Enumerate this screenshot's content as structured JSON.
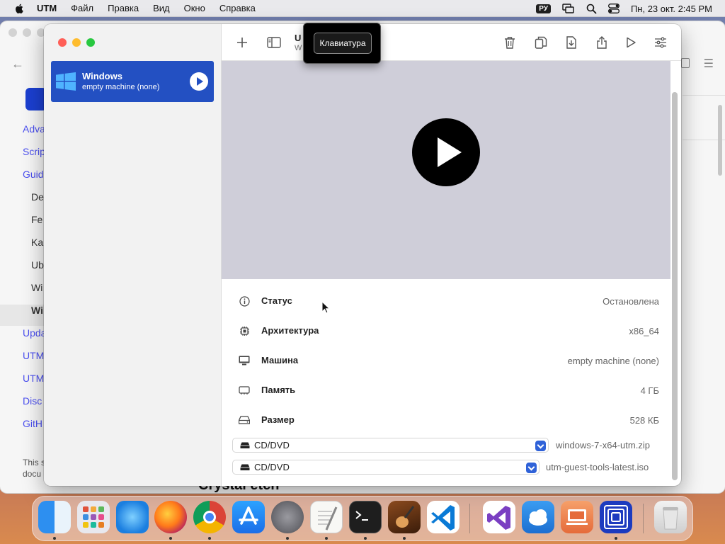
{
  "menubar": {
    "app_name": "UTM",
    "menus": [
      "Файл",
      "Правка",
      "Вид",
      "Окно",
      "Справка"
    ],
    "input_source": "РУ",
    "datetime": "Пн, 23 окт.  2:45 PM"
  },
  "background_window": {
    "sidebar_links": [
      "Adva",
      "Scrip",
      "Guid",
      "Upda",
      "UTM",
      "UTM",
      "Disc",
      "GitH"
    ],
    "sidebar_sublinks": [
      "De",
      "Fe",
      "Ka",
      "Ub",
      "Wi",
      "Wi"
    ],
    "footer_lines": [
      "This s",
      "docu"
    ],
    "heading_fragment": "Crystal etch"
  },
  "utm": {
    "vm": {
      "name": "Windows",
      "subtitle": "empty machine (none)"
    },
    "toolbar": {
      "title_fragment": "U",
      "subtitle_fragment": "W"
    },
    "tooltip": "Клавиатура",
    "info_rows": [
      {
        "icon": "info-icon",
        "label": "Статус",
        "value": "Остановлена"
      },
      {
        "icon": "cpu-icon",
        "label": "Архитектура",
        "value": "x86_64"
      },
      {
        "icon": "monitor-icon",
        "label": "Машина",
        "value": "empty machine (none)"
      },
      {
        "icon": "memory-icon",
        "label": "Память",
        "value": "4 ГБ"
      },
      {
        "icon": "disk-icon",
        "label": "Размер",
        "value": "528 КБ"
      }
    ],
    "drives": [
      {
        "label": "CD/DVD",
        "value": "windows-7-x64-utm.zip"
      },
      {
        "label": "CD/DVD",
        "value": "utm-guest-tools-latest.iso"
      }
    ]
  },
  "dock": {
    "apps": [
      "Finder",
      "Launchpad",
      "Safari",
      "Firefox",
      "Chrome",
      "App Store",
      "System Settings",
      "TextEdit",
      "Terminal",
      "GarageBand",
      "Visual Studio Code",
      "Visual Studio",
      "iCloud",
      "Remote Desktop",
      "UTM",
      "Trash"
    ]
  },
  "colors": {
    "accent": "#2350c2",
    "preview_bg": "#cfced9",
    "link": "#4b4ff0"
  }
}
